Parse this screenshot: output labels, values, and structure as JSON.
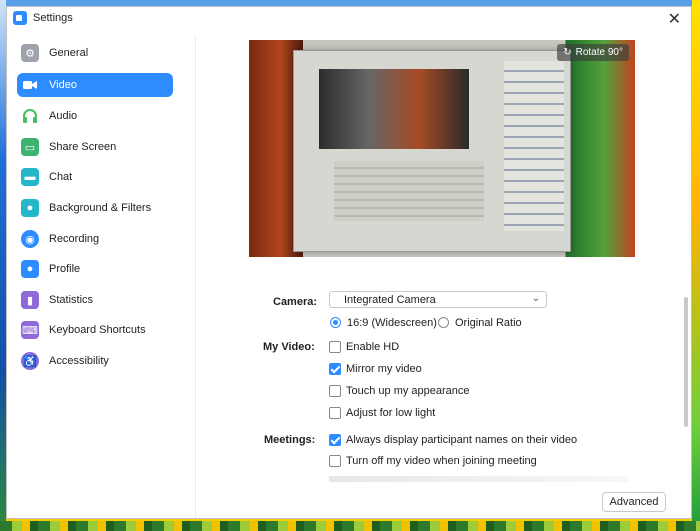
{
  "window": {
    "title": "Settings"
  },
  "sidebar": {
    "items": [
      {
        "label": "General",
        "icon": "gear-icon",
        "color": "#9ea3ab"
      },
      {
        "label": "Video",
        "icon": "video-camera-icon",
        "color": "#2d8cff",
        "active": true
      },
      {
        "label": "Audio",
        "icon": "headphones-icon",
        "color": "#43c061"
      },
      {
        "label": "Share Screen",
        "icon": "share-screen-icon",
        "color": "#3cb371"
      },
      {
        "label": "Chat",
        "icon": "chat-bubble-icon",
        "color": "#25b6c9"
      },
      {
        "label": "Background & Filters",
        "icon": "person-background-icon",
        "color": "#25b6c9"
      },
      {
        "label": "Recording",
        "icon": "record-icon",
        "color": "#2d8cff"
      },
      {
        "label": "Profile",
        "icon": "user-icon",
        "color": "#2d8cff"
      },
      {
        "label": "Statistics",
        "icon": "bar-chart-icon",
        "color": "#8e6ad8"
      },
      {
        "label": "Keyboard Shortcuts",
        "icon": "keyboard-icon",
        "color": "#8e6ad8"
      },
      {
        "label": "Accessibility",
        "icon": "accessibility-icon",
        "color": "#8e6ad8"
      }
    ]
  },
  "preview": {
    "rotate_label": "Rotate 90°"
  },
  "camera": {
    "label": "Camera:",
    "selected": "Integrated Camera"
  },
  "aspect": {
    "widescreen": {
      "label": "16:9 (Widescreen)",
      "selected": true
    },
    "original": {
      "label": "Original Ratio",
      "selected": false
    }
  },
  "my_video": {
    "label": "My Video:",
    "options": [
      {
        "label": "Enable HD",
        "checked": false
      },
      {
        "label": "Mirror my video",
        "checked": true
      },
      {
        "label": "Touch up my appearance",
        "checked": false
      },
      {
        "label": "Adjust for low light",
        "checked": false
      }
    ]
  },
  "meetings": {
    "label": "Meetings:",
    "options": [
      {
        "label": "Always display participant names on their video",
        "checked": true
      },
      {
        "label": "Turn off my video when joining meeting",
        "checked": false
      }
    ]
  },
  "advanced_label": "Advanced"
}
